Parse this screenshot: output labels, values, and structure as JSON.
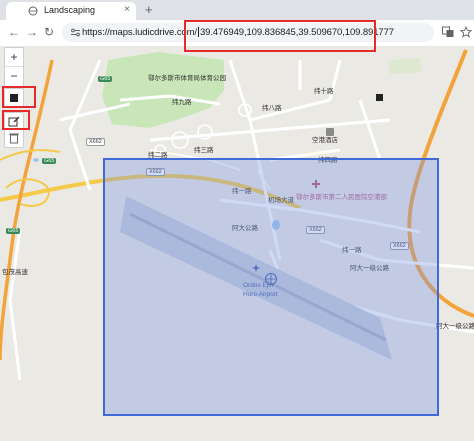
{
  "browser": {
    "tab_title": "Landscaping",
    "new_tab_label": "+",
    "close_label": "×",
    "tabs_menu": "⌄",
    "url_host": "https://maps.ludicdrive.com/",
    "url_coords": "39.476949,109.836845,39.509670,109.891777"
  },
  "map_controls": {
    "zoom_in": "+",
    "zoom_out": "−"
  },
  "map_labels": {
    "park": "鄂尔多斯市体育局体育公园",
    "road_10": "纬十路",
    "road_9": "纬九路",
    "road_8": "纬八路",
    "road_2": "纬二路",
    "road_3": "纬三路",
    "road_4": "纬四路",
    "road_1": "纬一路",
    "road_1_east": "纬一路",
    "hospital": "鄂尔多斯市第二人民医院空港部",
    "hotel": "空港酒店",
    "airport_road": "机场大道",
    "airport_name_cn": "Ordos Ejin",
    "airport_name_en": "Horo Airport",
    "east_road_1": "阿大一级公路",
    "east_road_2": "阿大一级公路",
    "west_road": "包茂高速",
    "south_road": "阿大公路",
    "highway_x662": "X662",
    "highway_g65": "G65",
    "highway_g65b": "G65",
    "highway_g65c": "G65",
    "x662_a": "X662",
    "x662_b": "X662",
    "x662_c": "X662"
  },
  "colors": {
    "accent_red": "#e32b2b",
    "selection_blue": "#3f6ad8"
  }
}
